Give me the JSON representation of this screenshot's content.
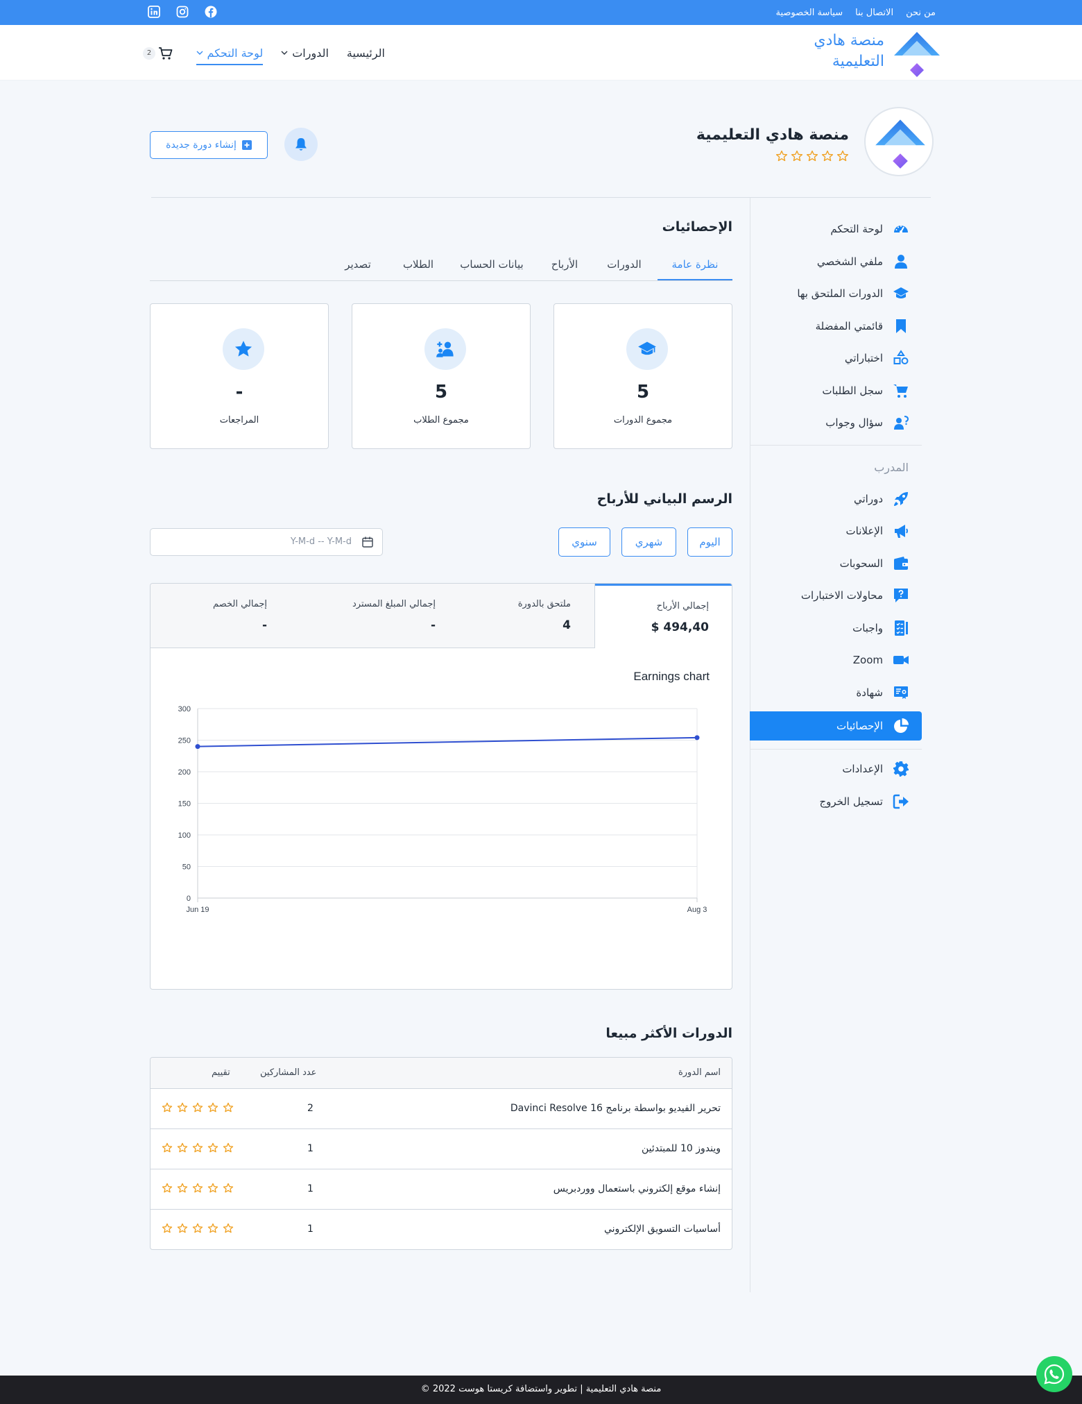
{
  "topbar": {
    "links": [
      "من نحن",
      "الاتصال بنا",
      "سياسة الخصوصية"
    ],
    "social_icons": [
      "facebook-icon",
      "instagram-icon",
      "linkedin-icon"
    ]
  },
  "header": {
    "brand_line1": "منصة هادي",
    "brand_line2": "التعليمية",
    "nav": [
      {
        "label": "الرئيسية"
      },
      {
        "label": "الدورات"
      },
      {
        "label": "لوحة التحكم"
      }
    ],
    "cart_count": "2"
  },
  "profile": {
    "name": "منصة هادي التعليمية",
    "new_course_label": "إنشاء دورة جديدة"
  },
  "sidebar": {
    "items": [
      {
        "label": "لوحة التحكم",
        "icon": "dashboard-icon"
      },
      {
        "label": "ملفي الشخصي",
        "icon": "user-icon"
      },
      {
        "label": "الدورات الملتحق بها",
        "icon": "graduation-cap-icon"
      },
      {
        "label": "قائمتي المفضلة",
        "icon": "bookmark-icon"
      },
      {
        "label": "اختباراتي",
        "icon": "shapes-icon"
      },
      {
        "label": "سجل الطلبات",
        "icon": "cart-icon"
      },
      {
        "label": "سؤال وجواب",
        "icon": "qa-icon"
      }
    ],
    "section_label": "المدرب",
    "instructor_items": [
      {
        "label": "دوراتي",
        "icon": "rocket-icon"
      },
      {
        "label": "الإعلانات",
        "icon": "megaphone-icon"
      },
      {
        "label": "السحوبات",
        "icon": "wallet-icon"
      },
      {
        "label": "محاولات الاختبارات",
        "icon": "quiz-attempts-icon"
      },
      {
        "label": "واجبات",
        "icon": "assignments-icon"
      },
      {
        "label": "Zoom",
        "icon": "video-icon"
      },
      {
        "label": "شهادة",
        "icon": "certificate-icon"
      },
      {
        "label": "الإحصائيات",
        "icon": "pie-chart-icon"
      }
    ],
    "bottom_items": [
      {
        "label": "الإعدادات",
        "icon": "gear-icon"
      },
      {
        "label": "تسجيل الخروج",
        "icon": "logout-icon"
      }
    ]
  },
  "stats": {
    "title": "الإحصائيات",
    "tabs": [
      "نظرة عامة",
      "الدورات",
      "الأرباح",
      "بيانات الحساب",
      "الطلاب",
      "تصدير"
    ],
    "cards": [
      {
        "value": "5",
        "label": "مجموع الدورات",
        "icon": "graduation-cap-icon"
      },
      {
        "value": "5",
        "label": "مجموع الطلاب",
        "icon": "students-icon"
      },
      {
        "value": "-",
        "label": "المراجعات",
        "icon": "star-icon"
      }
    ]
  },
  "earnings": {
    "title": "الرسم البياني للأرباح",
    "period_buttons": [
      "اليوم",
      "شهري",
      "سنوي"
    ],
    "date_placeholder": "Y-M-d -- Y-M-d",
    "summary": [
      {
        "label": "إجمالي الأرباح",
        "value": "$ 494,40"
      },
      {
        "label": "ملتحق بالدورة",
        "value": "4"
      },
      {
        "label": "إجمالي المبلغ المسترد",
        "value": "-"
      },
      {
        "label": "إجمالي الخصم",
        "value": "-"
      }
    ]
  },
  "chart_data": {
    "type": "line",
    "title": "Earnings chart",
    "x": [
      "Jun 19",
      "Aug 3"
    ],
    "series": [
      {
        "values": [
          240,
          254
        ]
      }
    ],
    "ylim": [
      0,
      300
    ],
    "yticks": [
      0,
      50,
      100,
      150,
      200,
      250,
      300
    ],
    "grid": true,
    "color": "#2f4fd0"
  },
  "best_selling": {
    "title": "الدورات الأكثر مبيعا",
    "columns": [
      "اسم الدورة",
      "عدد المشاركين",
      "تقييم"
    ],
    "rows": [
      {
        "name": "تحرير الفيديو بواسطة برنامج Davinci Resolve 16",
        "count": "2"
      },
      {
        "name": "ويندوز 10 للمبتدئين",
        "count": "1"
      },
      {
        "name": "إنشاء موقع إلكتروني باستعمال ووردبريس",
        "count": "1"
      },
      {
        "name": "أساسيات التسويق الإلكتروني",
        "count": "1"
      }
    ]
  },
  "footer": {
    "text": "© 2022 منصة هادي التعليمية | تطوير واستضافة كريستا هوست"
  },
  "colors": {
    "primary": "#3a8df2",
    "star": "#f0a020",
    "footer": "#1f1f24"
  }
}
